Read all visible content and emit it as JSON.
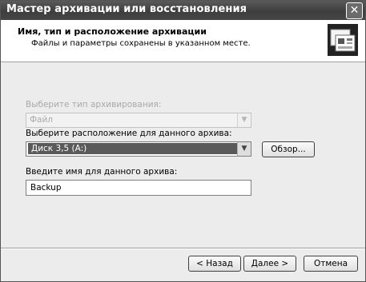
{
  "window": {
    "title": "Мастер архивации или восстановления",
    "close_glyph": "✕"
  },
  "header": {
    "title": "Имя, тип и расположение архивации",
    "subtitle": "Файлы и параметры сохранены в указанном месте.",
    "icon": "backup-wizard-icon"
  },
  "form": {
    "type_label": "Выберите тип архивирования:",
    "type_value": "Файл",
    "location_label": "Выберите расположение для данного архива:",
    "location_value": "Диск 3,5 (A:)",
    "browse_label": "Обзор...",
    "name_label": "Введите имя для данного архива:",
    "name_value": "Backup"
  },
  "footer": {
    "back_label": "< Назад",
    "next_label": "Далее >",
    "cancel_label": "Отмена"
  }
}
